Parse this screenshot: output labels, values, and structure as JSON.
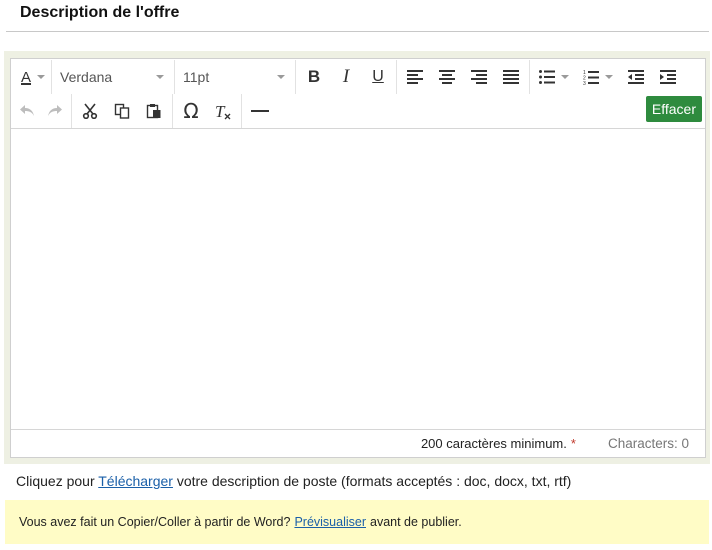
{
  "header": {
    "title": "Description de l'offre"
  },
  "toolbar": {
    "font_family": "Verdana",
    "font_size": "11pt",
    "text_color_glyph": "A",
    "clear_label": "Effacer",
    "icons": [
      "text-color-icon",
      "bold-icon",
      "italic-icon",
      "underline-icon",
      "align-left-icon",
      "align-center-icon",
      "align-right-icon",
      "align-justify-icon",
      "bullet-list-icon",
      "numbered-list-icon",
      "outdent-icon",
      "indent-icon",
      "undo-icon",
      "redo-icon",
      "cut-icon",
      "copy-icon",
      "paste-icon",
      "special-char-icon",
      "clear-format-icon",
      "horizontal-rule-icon"
    ]
  },
  "editor": {
    "content": ""
  },
  "status": {
    "min_chars": "200 caractères minimum.",
    "required_mark": "*",
    "char_count": "Characters: 0"
  },
  "upload": {
    "prefix": "Cliquez pour",
    "link": "Télécharger",
    "suffix": "votre description de poste (formats acceptés : doc, docx, txt, rtf)"
  },
  "notice": {
    "prefix": "Vous avez fait un Copier/Coller à partir de Word?",
    "link": "Prévisualiser",
    "suffix": "avant de publier."
  },
  "colors": {
    "accent_green": "#2e8b3e",
    "link": "#1a5fa8",
    "notice_bg": "#fffcc6",
    "frame_bg": "#eef0e3"
  }
}
